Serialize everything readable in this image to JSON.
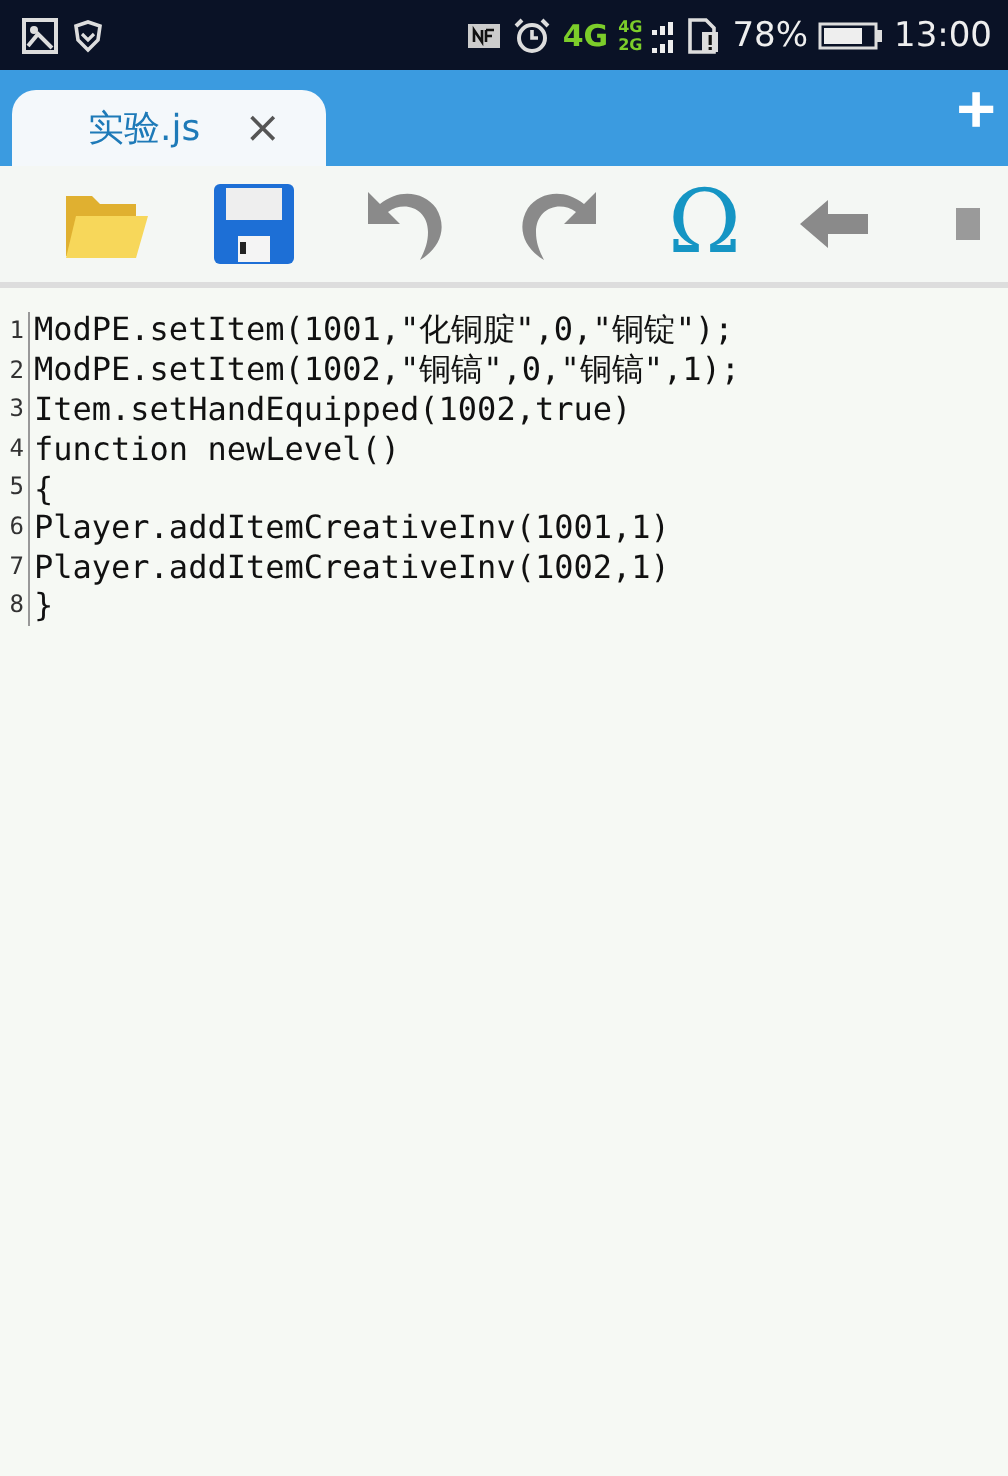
{
  "status_bar": {
    "network": "4G",
    "signal_labels": [
      "4G",
      "2G"
    ],
    "battery": "78%",
    "time": "13:00"
  },
  "tabs": [
    {
      "label": "实验.js",
      "close": "×",
      "selected": true
    }
  ],
  "new_tab": "+",
  "toolbar": {
    "omega": "Ω"
  },
  "editor": {
    "lines": [
      {
        "number": "1",
        "text": "ModPE.setItem(1001,\"化铜腚\",0,\"铜锭\");"
      },
      {
        "number": "2",
        "text": "ModPE.setItem(1002,\"铜镐\",0,\"铜镐\",1);"
      },
      {
        "number": "3",
        "text": "Item.setHandEquipped(1002,true)"
      },
      {
        "number": "4",
        "text": "function newLevel()"
      },
      {
        "number": "5",
        "text": "{"
      },
      {
        "number": "6",
        "text": "Player.addItemCreativeInv(1001,1)"
      },
      {
        "number": "7",
        "text": "Player.addItemCreativeInv(1002,1)"
      },
      {
        "number": "8",
        "text": "}"
      }
    ]
  }
}
